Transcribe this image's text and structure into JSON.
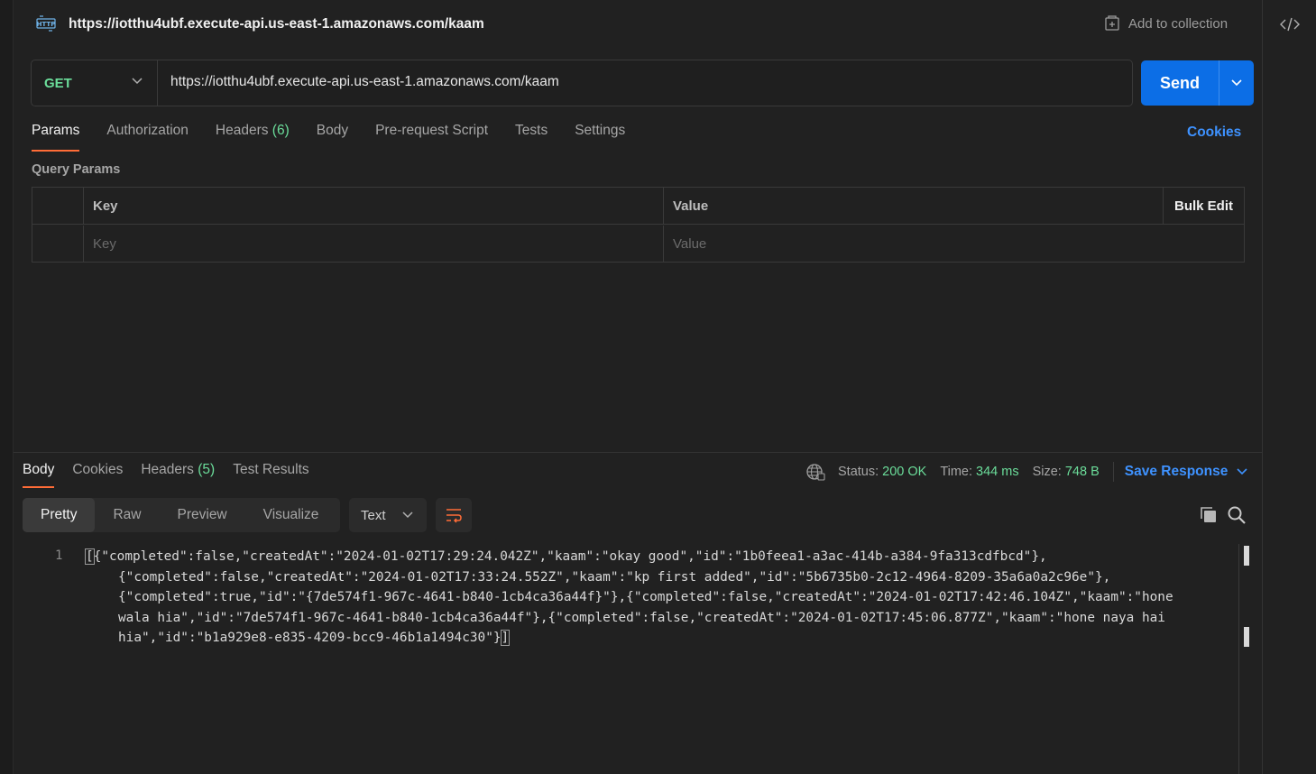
{
  "title_bar": {
    "http_icon": "http-icon",
    "url": "https://iotthu4ubf.execute-api.us-east-1.amazonaws.com/kaam",
    "add_to_collection": "Add to collection"
  },
  "request": {
    "method": "GET",
    "url": "https://iotthu4ubf.execute-api.us-east-1.amazonaws.com/kaam",
    "send_label": "Send"
  },
  "request_tabs": [
    {
      "label": "Params",
      "active": true
    },
    {
      "label": "Authorization"
    },
    {
      "label": "Headers",
      "count": "(6)"
    },
    {
      "label": "Body"
    },
    {
      "label": "Pre-request Script"
    },
    {
      "label": "Tests"
    },
    {
      "label": "Settings"
    }
  ],
  "cookies_link": "Cookies",
  "query_params": {
    "title": "Query Params",
    "headers": {
      "key": "Key",
      "value": "Value",
      "bulk_edit": "Bulk Edit"
    },
    "placeholders": {
      "key": "Key",
      "value": "Value"
    }
  },
  "response": {
    "tabs": [
      {
        "label": "Body",
        "active": true
      },
      {
        "label": "Cookies"
      },
      {
        "label": "Headers",
        "count": "(5)"
      },
      {
        "label": "Test Results"
      }
    ],
    "status": {
      "label": "Status:",
      "value": "200 OK"
    },
    "time": {
      "label": "Time:",
      "value": "344 ms"
    },
    "size": {
      "label": "Size:",
      "value": "748 B"
    },
    "save_response": "Save Response",
    "views": [
      {
        "label": "Pretty",
        "active": true
      },
      {
        "label": "Raw"
      },
      {
        "label": "Preview"
      },
      {
        "label": "Visualize"
      }
    ],
    "format": "Text",
    "line_number": "1",
    "body_lines": [
      {
        "open": "[",
        "text": "{\"completed\":false,\"createdAt\":\"2024-01-02T17:29:24.042Z\",\"kaam\":\"okay good\",\"id\":\"1b0feea1-a3ac-414b-a384-9fa313cdfbcd\"},"
      },
      {
        "text": "{\"completed\":false,\"createdAt\":\"2024-01-02T17:33:24.552Z\",\"kaam\":\"kp first added\",\"id\":\"5b6735b0-2c12-4964-8209-35a6a0a2c96e\"},"
      },
      {
        "text": "{\"completed\":true,\"id\":\"{7de574f1-967c-4641-b840-1cb4ca36a44f}\"},{\"completed\":false,\"createdAt\":\"2024-01-02T17:42:46.104Z\",\"kaam\":\"hone"
      },
      {
        "text": "wala hia\",\"id\":\"7de574f1-967c-4641-b840-1cb4ca36a44f\"},{\"completed\":false,\"createdAt\":\"2024-01-02T17:45:06.877Z\",\"kaam\":\"hone naya hai"
      },
      {
        "text": "hia\",\"id\":\"b1a929e8-e835-4209-bcc9-46b1a1494c30\"}",
        "close": "]"
      }
    ]
  },
  "icons": {
    "code": "code-icon",
    "collection": "add-to-collection-icon",
    "chevron": "chevron-down-icon",
    "globe": "globe-icon",
    "wrap": "wrap-lines-icon",
    "copy": "copy-icon",
    "search": "search-icon"
  },
  "colors": {
    "accent": "#ff6c37",
    "send": "#0c6ee6",
    "success": "#6bdd9a",
    "link": "#3e92ff"
  }
}
